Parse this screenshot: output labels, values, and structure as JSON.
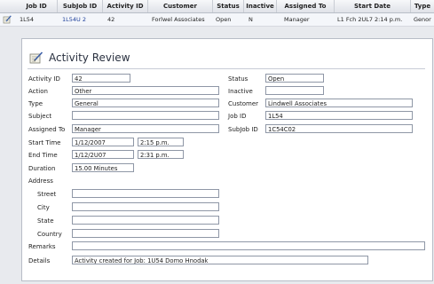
{
  "grid": {
    "columns": [
      "Job ID",
      "SubJob ID",
      "Activity ID",
      "Customer",
      "Status",
      "Inactive",
      "Assigned To",
      "Start Date",
      "Type"
    ],
    "row": {
      "icon": "activity-note-icon",
      "values": [
        "1L54",
        "1L54U 2",
        "42",
        "Forlwel Associates",
        "Open",
        "N",
        "Manager",
        "L1 Fch 2UL7 2:14 p.m.",
        "Genor"
      ]
    }
  },
  "panel": {
    "title": "Activity Review",
    "title_icon": "activity-review-icon"
  },
  "form": {
    "activity_id": {
      "label": "Activity ID",
      "value": "42"
    },
    "action": {
      "label": "Action",
      "value": "Other"
    },
    "type": {
      "label": "Type",
      "value": "General"
    },
    "subject": {
      "label": "Subject",
      "value": ""
    },
    "assigned_to": {
      "label": "Assigned To",
      "value": "Manager"
    },
    "start_time": {
      "label": "Start Time",
      "date": "1/12/2007",
      "time": "2:15 p.m."
    },
    "end_time": {
      "label": "End Time",
      "date": "1/12/2U07",
      "time": "2:31 p.m."
    },
    "duration": {
      "label": "Duration",
      "value": "15.00 Minutes"
    },
    "address": {
      "label": "Address",
      "street": {
        "label": "Street",
        "value": ""
      },
      "city": {
        "label": "City",
        "value": ""
      },
      "state": {
        "label": "State",
        "value": ""
      },
      "country": {
        "label": "Country",
        "value": ""
      }
    },
    "remarks": {
      "label": "Remarks",
      "value": ""
    },
    "details": {
      "label": "Details",
      "value": "Activity created for Job: 1U54 Domo Hnodak"
    },
    "status": {
      "label": "Status",
      "value": "Open"
    },
    "inactive": {
      "label": "Inactive",
      "value": ""
    },
    "customer": {
      "label": "Customer",
      "value": "Lindwell Associates"
    },
    "job_id": {
      "label": "Job ID",
      "value": "1L54"
    },
    "subjob_id": {
      "label": "SubJob ID",
      "value": "1C54C02"
    }
  }
}
